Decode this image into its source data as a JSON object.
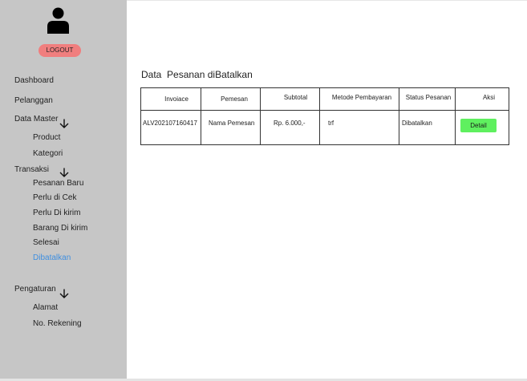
{
  "sidebar": {
    "logout_label": "LOGOUT",
    "items": {
      "dashboard": "Dashboard",
      "pelanggan": "Pelanggan",
      "data_master": "Data Master",
      "product": "Product",
      "kategori": "Kategori",
      "transaksi": "Transaksi",
      "pesanan_baru": "Pesanan Baru",
      "perlu_di_cek": "Perlu di Cek",
      "perlu_di_kirim": "Perlu Di kirim",
      "barang_di_kirim": "Barang Di kirim",
      "selesai": "Selesai",
      "dibatalkan": "Dibatalkan",
      "pengaturan": "Pengaturan",
      "alamat": "Alamat",
      "no_rekening": "No. Rekening"
    },
    "active_item": "Dibatalkan",
    "icons": [
      "user-avatar-icon",
      "arrow-down-icon"
    ]
  },
  "main": {
    "title": "Data  Pesanan diBatalkan",
    "table": {
      "headers": [
        "Invoiace",
        "Pemesan",
        "Subtotal",
        "Metode Pembayaran",
        "Status Pesanan",
        "Aksi"
      ],
      "rows": [
        {
          "invoice": "ALV202107160417",
          "pemesan": "Nama Pemesan",
          "subtotal": "Rp. 6.000,-",
          "metode": "trf",
          "status": "Dibatalkan",
          "aksi_label": "Detail"
        }
      ]
    }
  },
  "colors": {
    "sidebar_bg": "#c6c6c6",
    "logout_bg": "#f07e7e",
    "active_link": "#3f8fe0",
    "detail_button_bg": "#5ff05f"
  }
}
